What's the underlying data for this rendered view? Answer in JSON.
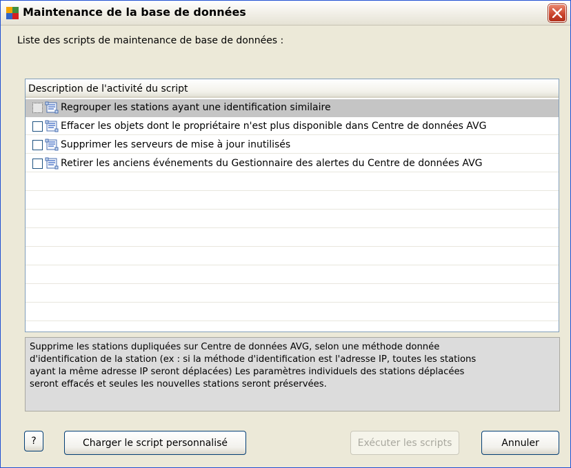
{
  "window": {
    "title": "Maintenance de la base de données"
  },
  "list": {
    "caption": "Liste des scripts de maintenance de base de données :",
    "column_header": "Description de l'activité du script",
    "rows": [
      {
        "label": "Regrouper les stations ayant une identification similaire",
        "selected": true,
        "checked": false
      },
      {
        "label": "Effacer les objets dont le propriétaire n'est plus disponible dans Centre de données AVG",
        "selected": false,
        "checked": false
      },
      {
        "label": "Supprimer les serveurs de mise à jour inutilisés",
        "selected": false,
        "checked": false
      },
      {
        "label": "Retirer les anciens événements du Gestionnaire des alertes du Centre de données AVG",
        "selected": false,
        "checked": false
      }
    ]
  },
  "description": {
    "lines": [
      "Supprime les stations dupliquées sur Centre de données AVG, selon une méthode donnée",
      "d'identification de la station (ex : si la méthode d'identification est l'adresse IP, toutes les stations",
      "ayant la même adresse IP seront déplacées) Les paramètres individuels des stations déplacées",
      "seront effacés et seules les nouvelles stations seront préservées."
    ]
  },
  "buttons": {
    "help": "?",
    "load_custom": "Charger le script personnalisé",
    "run": "Exécuter les scripts",
    "cancel": "Annuler"
  },
  "colors": {
    "dialog_bg": "#ece9d8",
    "selected_row": "#c5c5c5",
    "close_button": "#c9432b"
  },
  "icons": {
    "app": "avg-logo-icon",
    "close": "close-icon",
    "script": "script-scroll-icon"
  }
}
